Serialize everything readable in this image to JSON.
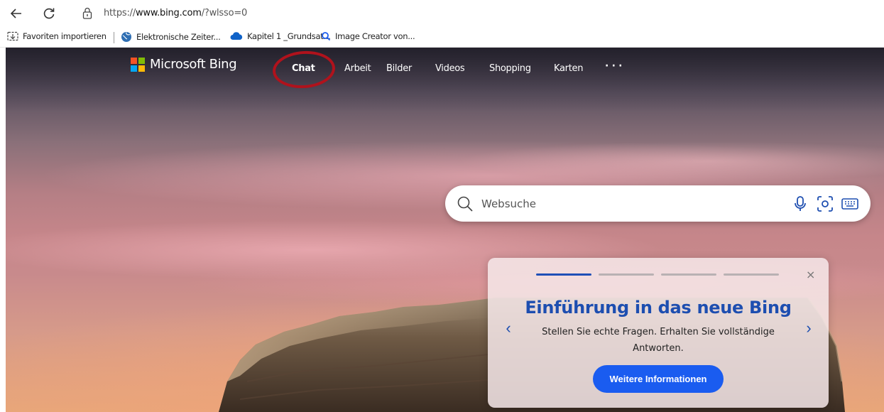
{
  "browser": {
    "url_prefix": "https://",
    "url_domain": "www.bing.com",
    "url_path": "/?wlsso=0"
  },
  "favorites": [
    {
      "label": "Favoriten importieren",
      "icon": "import-icon"
    },
    {
      "label": "Elektronische Zeiter...",
      "icon": "globe-icon"
    },
    {
      "label": "Kapitel 1 _Grundsat...",
      "icon": "onedrive-icon"
    },
    {
      "label": "Image Creator von...",
      "icon": "search-icon"
    }
  ],
  "header": {
    "brand": "Microsoft Bing",
    "nav": [
      "Chat",
      "Arbeit",
      "Bilder",
      "Videos",
      "Shopping",
      "Karten",
      "· · ·"
    ],
    "active": "Chat"
  },
  "search": {
    "placeholder": "Websuche"
  },
  "card": {
    "title": "Einführung in das neue Bing",
    "text": "Stellen Sie echte Fragen. Erhalten Sie vollständige Antworten.",
    "button": "Weitere Informationen",
    "close": "×",
    "slides": 4,
    "active_slide": 1,
    "prev": "‹",
    "next": "›"
  },
  "colors": {
    "accent": "#1a5cf0",
    "title": "#1d4eb0",
    "annotation": "#b0121c",
    "logo": [
      "#f35325",
      "#81bc06",
      "#05a6f0",
      "#ffba08"
    ]
  }
}
